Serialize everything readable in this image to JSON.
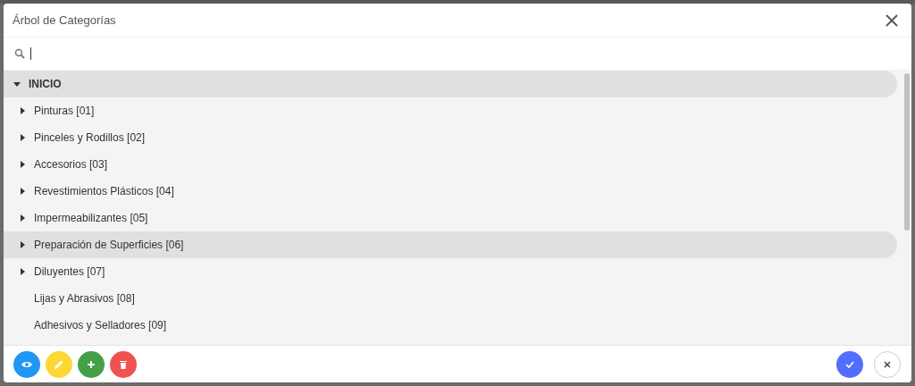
{
  "dialog": {
    "title": "Árbol de Categorías"
  },
  "search": {
    "focused": true
  },
  "tree": [
    {
      "label": "INICIO",
      "expanded": true,
      "expandable": true,
      "highlighted": true,
      "children": [
        {
          "label": "Pinturas [01]",
          "expanded": false,
          "expandable": true,
          "highlighted": false
        },
        {
          "label": "Pinceles y Rodillos [02]",
          "expanded": false,
          "expandable": true,
          "highlighted": false
        },
        {
          "label": "Accesorios [03]",
          "expanded": false,
          "expandable": true,
          "highlighted": false
        },
        {
          "label": "Revestimientos Plásticos [04]",
          "expanded": false,
          "expandable": true,
          "highlighted": false
        },
        {
          "label": "Impermeabilizantes [05]",
          "expanded": false,
          "expandable": true,
          "highlighted": false
        },
        {
          "label": "Preparación de Superficies [06]",
          "expanded": false,
          "expandable": true,
          "highlighted": true
        },
        {
          "label": "Diluyentes [07]",
          "expanded": false,
          "expandable": true,
          "highlighted": false
        },
        {
          "label": "Lijas y Abrasivos [08]",
          "expandable": false,
          "highlighted": false
        },
        {
          "label": "Adhesivos y Selladores [09]",
          "expandable": false,
          "highlighted": false
        }
      ]
    }
  ],
  "actions": [
    {
      "kind": "view"
    },
    {
      "kind": "edit"
    },
    {
      "kind": "add"
    },
    {
      "kind": "delete"
    }
  ],
  "footer_buttons": [
    {
      "kind": "confirm"
    },
    {
      "kind": "cancel"
    }
  ]
}
